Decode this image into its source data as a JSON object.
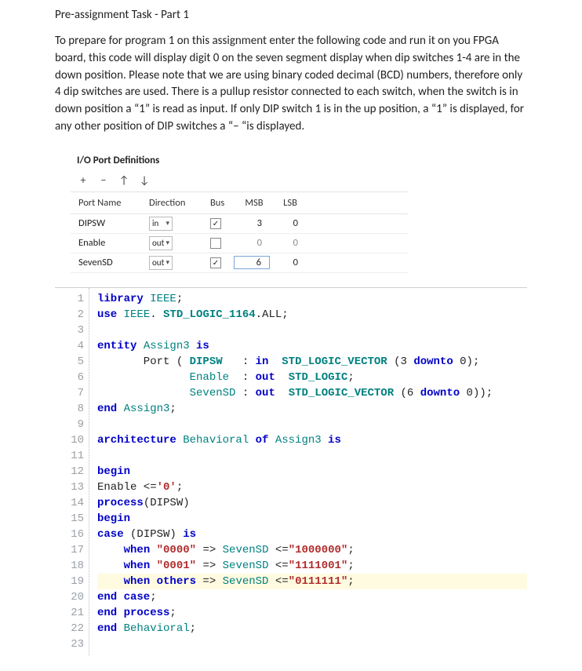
{
  "title": "Pre-assignment Task - Part 1",
  "intro": "To prepare for program 1 on this assignment enter the following code and run it on you FPGA board, this code will display digit 0 on the seven segment display when dip switches 1-4 are in the down position.  Please note that we are using binary coded decimal (BCD) numbers, therefore only 4 dip switches are used.  There is a pullup resistor connected to each switch, when the switch is in down position a “1” is read as input.  If only DIP switch 1 is in the up position, a “1” is displayed, for any other position of DIP switches a “– “is displayed.",
  "panel": {
    "title": "I/O Port Definitions",
    "toolbar": {
      "add": "+",
      "remove": "−",
      "up": "↑",
      "down": "↓"
    },
    "headers": {
      "name": "Port Name",
      "direction": "Direction",
      "bus": "Bus",
      "msb": "MSB",
      "lsb": "LSB"
    },
    "rows": [
      {
        "name": "DIPSW",
        "direction": "in",
        "bus_checked": true,
        "msb": "3",
        "lsb": "0",
        "on": true,
        "boxed": false
      },
      {
        "name": "Enable",
        "direction": "out",
        "bus_checked": false,
        "msb": "0",
        "lsb": "0",
        "on": false,
        "boxed": false
      },
      {
        "name": "SevenSD",
        "direction": "out",
        "bus_checked": true,
        "msb": "6",
        "lsb": "0",
        "on": true,
        "boxed": true
      }
    ]
  },
  "code": {
    "lines": [
      {
        "n": 1,
        "hl": false,
        "segs": [
          [
            "kw1",
            "library "
          ],
          [
            "ident",
            "IEEE"
          ],
          [
            "",
            ";"
          ]
        ]
      },
      {
        "n": 2,
        "hl": false,
        "segs": [
          [
            "kw1",
            "use "
          ],
          [
            "ident",
            "IEEE"
          ],
          [
            "",
            ". "
          ],
          [
            "type",
            "STD_LOGIC_1164"
          ],
          [
            "",
            ".ALL;"
          ]
        ]
      },
      {
        "n": 3,
        "hl": false,
        "segs": [
          [
            "",
            ""
          ]
        ]
      },
      {
        "n": 4,
        "hl": false,
        "segs": [
          [
            "kw1",
            "entity "
          ],
          [
            "ident",
            "Assign3"
          ],
          [
            "kw1",
            " is"
          ]
        ]
      },
      {
        "n": 5,
        "hl": false,
        "segs": [
          [
            "",
            "       Port ( "
          ],
          [
            "type",
            "DIPSW"
          ],
          [
            "",
            "   : "
          ],
          [
            "kw1",
            "in"
          ],
          [
            "",
            "  "
          ],
          [
            "type",
            "STD_LOGIC_VECTOR"
          ],
          [
            "",
            ""
          ],
          [
            "",
            " (3 "
          ],
          [
            "kw1",
            "downto"
          ],
          [
            "",
            " 0);"
          ]
        ]
      },
      {
        "n": 6,
        "hl": false,
        "segs": [
          [
            "",
            "              "
          ],
          [
            "ident",
            "Enable"
          ],
          [
            "",
            "  : "
          ],
          [
            "kw1",
            "out"
          ],
          [
            "",
            "  "
          ],
          [
            "type",
            "STD_LOGIC"
          ],
          [
            "",
            ";"
          ]
        ]
      },
      {
        "n": 7,
        "hl": false,
        "segs": [
          [
            "",
            "              "
          ],
          [
            "ident",
            "SevenSD"
          ],
          [
            "",
            " : "
          ],
          [
            "kw1",
            "out"
          ],
          [
            "",
            "  "
          ],
          [
            "type",
            "STD_LOGIC_VECTOR"
          ],
          [
            "",
            " (6 "
          ],
          [
            "kw1",
            "downto"
          ],
          [
            "",
            " 0));"
          ]
        ]
      },
      {
        "n": 8,
        "hl": false,
        "segs": [
          [
            "kw1",
            "end "
          ],
          [
            "ident",
            "Assign3"
          ],
          [
            "",
            ";"
          ]
        ]
      },
      {
        "n": 9,
        "hl": false,
        "segs": [
          [
            "",
            ""
          ]
        ]
      },
      {
        "n": 10,
        "hl": false,
        "segs": [
          [
            "kw1",
            "architecture "
          ],
          [
            "ident",
            "Behavioral"
          ],
          [
            "kw1",
            " of "
          ],
          [
            "ident",
            "Assign3"
          ],
          [
            "kw1",
            " is"
          ]
        ]
      },
      {
        "n": 11,
        "hl": false,
        "segs": [
          [
            "",
            ""
          ]
        ]
      },
      {
        "n": 12,
        "hl": false,
        "segs": [
          [
            "kw1",
            "begin"
          ]
        ]
      },
      {
        "n": 13,
        "hl": false,
        "segs": [
          [
            "",
            "Enable <="
          ],
          [
            "str",
            "'0'"
          ],
          [
            "",
            ";"
          ]
        ]
      },
      {
        "n": 14,
        "hl": false,
        "segs": [
          [
            "kw1",
            "process"
          ],
          [
            "",
            "(DIPSW)"
          ]
        ]
      },
      {
        "n": 15,
        "hl": false,
        "segs": [
          [
            "kw1",
            "begin"
          ]
        ]
      },
      {
        "n": 16,
        "hl": false,
        "segs": [
          [
            "kw1",
            "case "
          ],
          [
            "",
            "(DIPSW) "
          ],
          [
            "kw1",
            "is"
          ]
        ]
      },
      {
        "n": 17,
        "hl": false,
        "segs": [
          [
            "",
            "    "
          ],
          [
            "kw1",
            "when "
          ],
          [
            "str",
            "\"0000\""
          ],
          [
            "",
            " => "
          ],
          [
            "ident",
            "SevenSD"
          ],
          [
            "",
            " <="
          ],
          [
            "str",
            "\"1000000\""
          ],
          [
            "",
            ";"
          ]
        ]
      },
      {
        "n": 18,
        "hl": false,
        "segs": [
          [
            "",
            "    "
          ],
          [
            "kw1",
            "when "
          ],
          [
            "str",
            "\"0001\""
          ],
          [
            "",
            " => "
          ],
          [
            "ident",
            "SevenSD"
          ],
          [
            "",
            " <="
          ],
          [
            "str",
            "\"1111001\""
          ],
          [
            "",
            ";"
          ]
        ]
      },
      {
        "n": 19,
        "hl": true,
        "segs": [
          [
            "",
            "    "
          ],
          [
            "kw1",
            "when others"
          ],
          [
            "",
            " => "
          ],
          [
            "ident",
            "SevenSD"
          ],
          [
            "",
            " <="
          ],
          [
            "str",
            "\"0111111\""
          ],
          [
            "",
            ";"
          ]
        ]
      },
      {
        "n": 20,
        "hl": false,
        "segs": [
          [
            "kw1",
            "end case"
          ],
          [
            "",
            ";"
          ]
        ]
      },
      {
        "n": 21,
        "hl": false,
        "segs": [
          [
            "kw1",
            "end process"
          ],
          [
            "",
            ";"
          ]
        ]
      },
      {
        "n": 22,
        "hl": false,
        "segs": [
          [
            "kw1",
            "end "
          ],
          [
            "ident",
            "Behavioral"
          ],
          [
            "",
            ";"
          ]
        ]
      },
      {
        "n": 23,
        "hl": false,
        "segs": [
          [
            "",
            ""
          ]
        ]
      }
    ]
  }
}
